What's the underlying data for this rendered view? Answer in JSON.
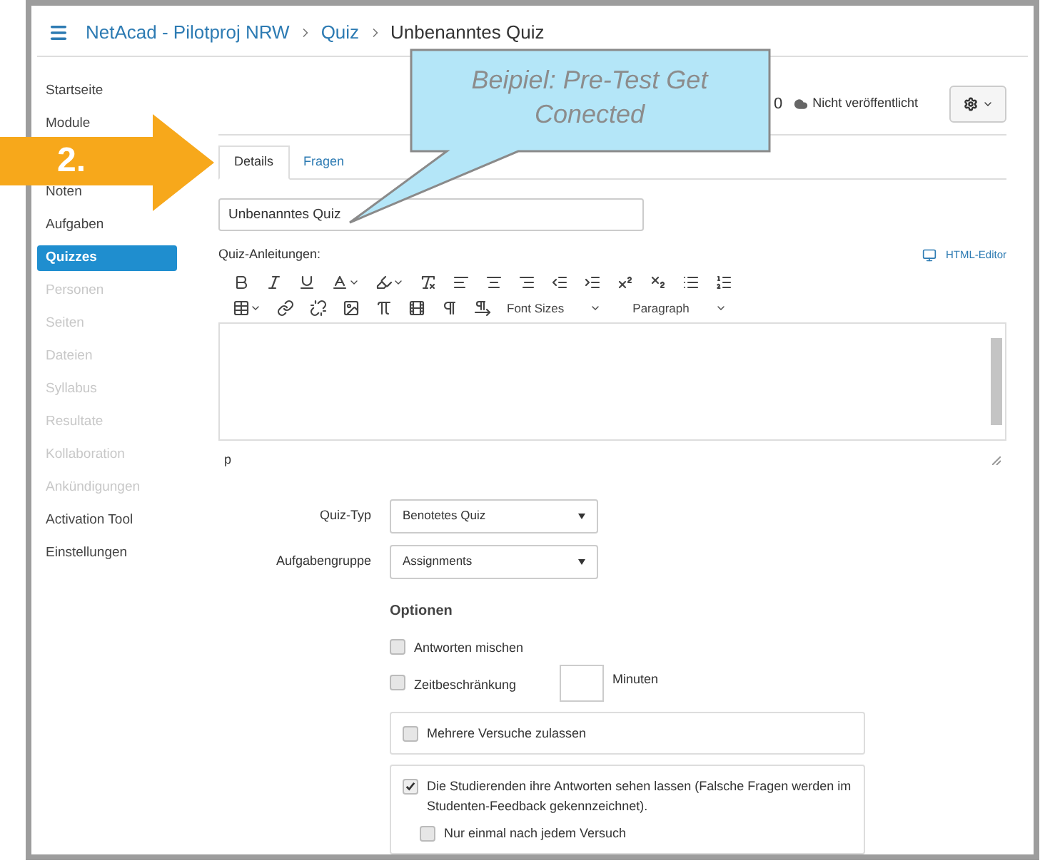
{
  "breadcrumb": [
    {
      "label": "NetAcad - Pilotproj NRW",
      "kind": "link"
    },
    {
      "label": "Quiz",
      "kind": "link"
    },
    {
      "label": "Unbenanntes Quiz",
      "kind": "current"
    }
  ],
  "sidebar": {
    "items": [
      {
        "label": "Startseite",
        "selected": false,
        "hidden": false
      },
      {
        "label": "Module",
        "selected": false,
        "hidden": false
      },
      {
        "label": "Noten",
        "selected": false,
        "hidden": false
      },
      {
        "label": "Aufgaben",
        "selected": false,
        "hidden": false
      },
      {
        "label": "Quizzes",
        "selected": true,
        "hidden": false
      },
      {
        "label": "Personen",
        "selected": false,
        "hidden": true
      },
      {
        "label": "Seiten",
        "selected": false,
        "hidden": true
      },
      {
        "label": "Dateien",
        "selected": false,
        "hidden": true
      },
      {
        "label": "Syllabus",
        "selected": false,
        "hidden": true
      },
      {
        "label": "Resultate",
        "selected": false,
        "hidden": true
      },
      {
        "label": "Kollaboration",
        "selected": false,
        "hidden": true
      },
      {
        "label": "Ankündigungen",
        "selected": false,
        "hidden": true
      },
      {
        "label": "Activation Tool",
        "selected": false,
        "hidden": false
      },
      {
        "label": "Einstellungen",
        "selected": false,
        "hidden": false
      }
    ]
  },
  "header": {
    "points": "0",
    "status": "Nicht veröffentlicht"
  },
  "tabs": [
    {
      "label": "Details",
      "selected": true
    },
    {
      "label": "Fragen",
      "selected": false
    }
  ],
  "title_field": {
    "value": "Unbenanntes Quiz"
  },
  "instructions": {
    "label": "Quiz-Anleitungen:",
    "html_editor_link": "HTML-Editor",
    "font_sizes": "Font Sizes",
    "paragraph": "Paragraph",
    "path": "p"
  },
  "settings": [
    {
      "label": "Quiz-Typ",
      "value": "Benotetes Quiz"
    },
    {
      "label": "Aufgabengruppe",
      "value": "Assignments"
    }
  ],
  "options": {
    "heading": "Optionen",
    "items": [
      {
        "kind": "plain",
        "label": "Antworten mischen",
        "checked": false
      },
      {
        "kind": "time",
        "label": "Zeitbeschränkung",
        "checked": false,
        "unit": "Minuten"
      },
      {
        "kind": "boxed",
        "label": "Mehrere Versuche zulassen",
        "checked": false
      },
      {
        "kind": "boxed",
        "label": "Die Studierenden ihre Antworten sehen lassen (Falsche Fragen werden im Studenten-Feedback gekennzeichnet).",
        "checked": true,
        "children": [
          {
            "label": "Nur einmal nach jedem Versuch",
            "checked": false
          }
        ]
      }
    ]
  },
  "annotations": {
    "callout": "Beipiel: Pre-Test Get Conected",
    "step": "2."
  }
}
